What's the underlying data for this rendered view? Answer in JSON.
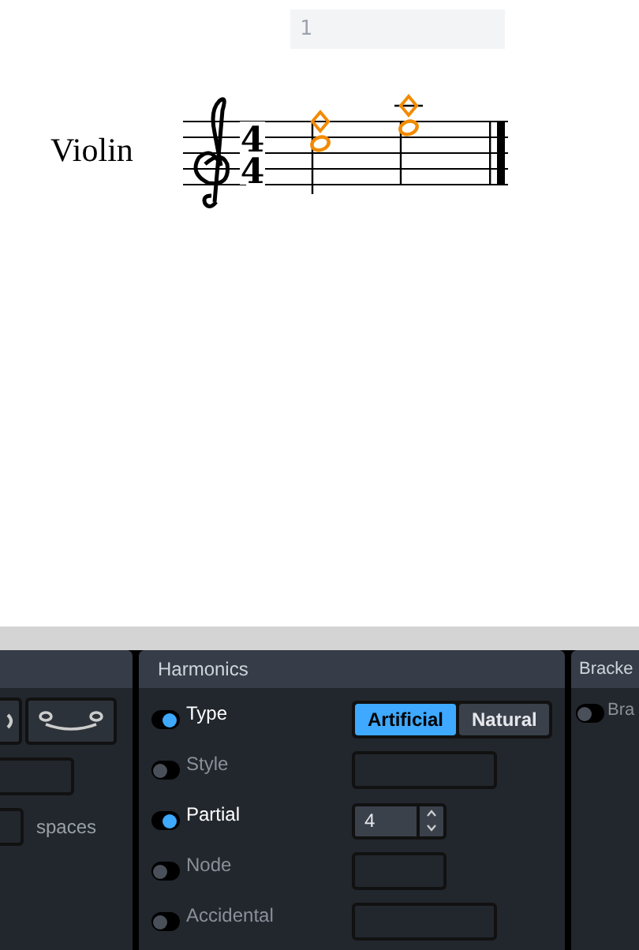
{
  "score": {
    "measure_number": "1",
    "instrument": "Violin",
    "time_signature": {
      "numerator": "4",
      "denominator": "4"
    },
    "notes": [
      {
        "selected": true,
        "ledger_line": false
      },
      {
        "selected": true,
        "ledger_line": true
      }
    ]
  },
  "left_panel": {
    "spacing_unit": "spaces"
  },
  "harmonics_panel": {
    "title": "Harmonics",
    "rows": [
      {
        "label": "Type",
        "on": true,
        "kind": "segmented",
        "options": [
          {
            "label": "Artificial",
            "selected": true
          },
          {
            "label": "Natural",
            "selected": false
          }
        ]
      },
      {
        "label": "Style",
        "on": false,
        "kind": "field"
      },
      {
        "label": "Partial",
        "on": true,
        "kind": "spinner",
        "value": "4"
      },
      {
        "label": "Node",
        "on": false,
        "kind": "short_field"
      },
      {
        "label": "Accidental",
        "on": false,
        "kind": "field"
      }
    ]
  },
  "brackets_panel": {
    "title": "Bracke",
    "rows": [
      {
        "label": "Bra",
        "on": false
      }
    ]
  }
}
